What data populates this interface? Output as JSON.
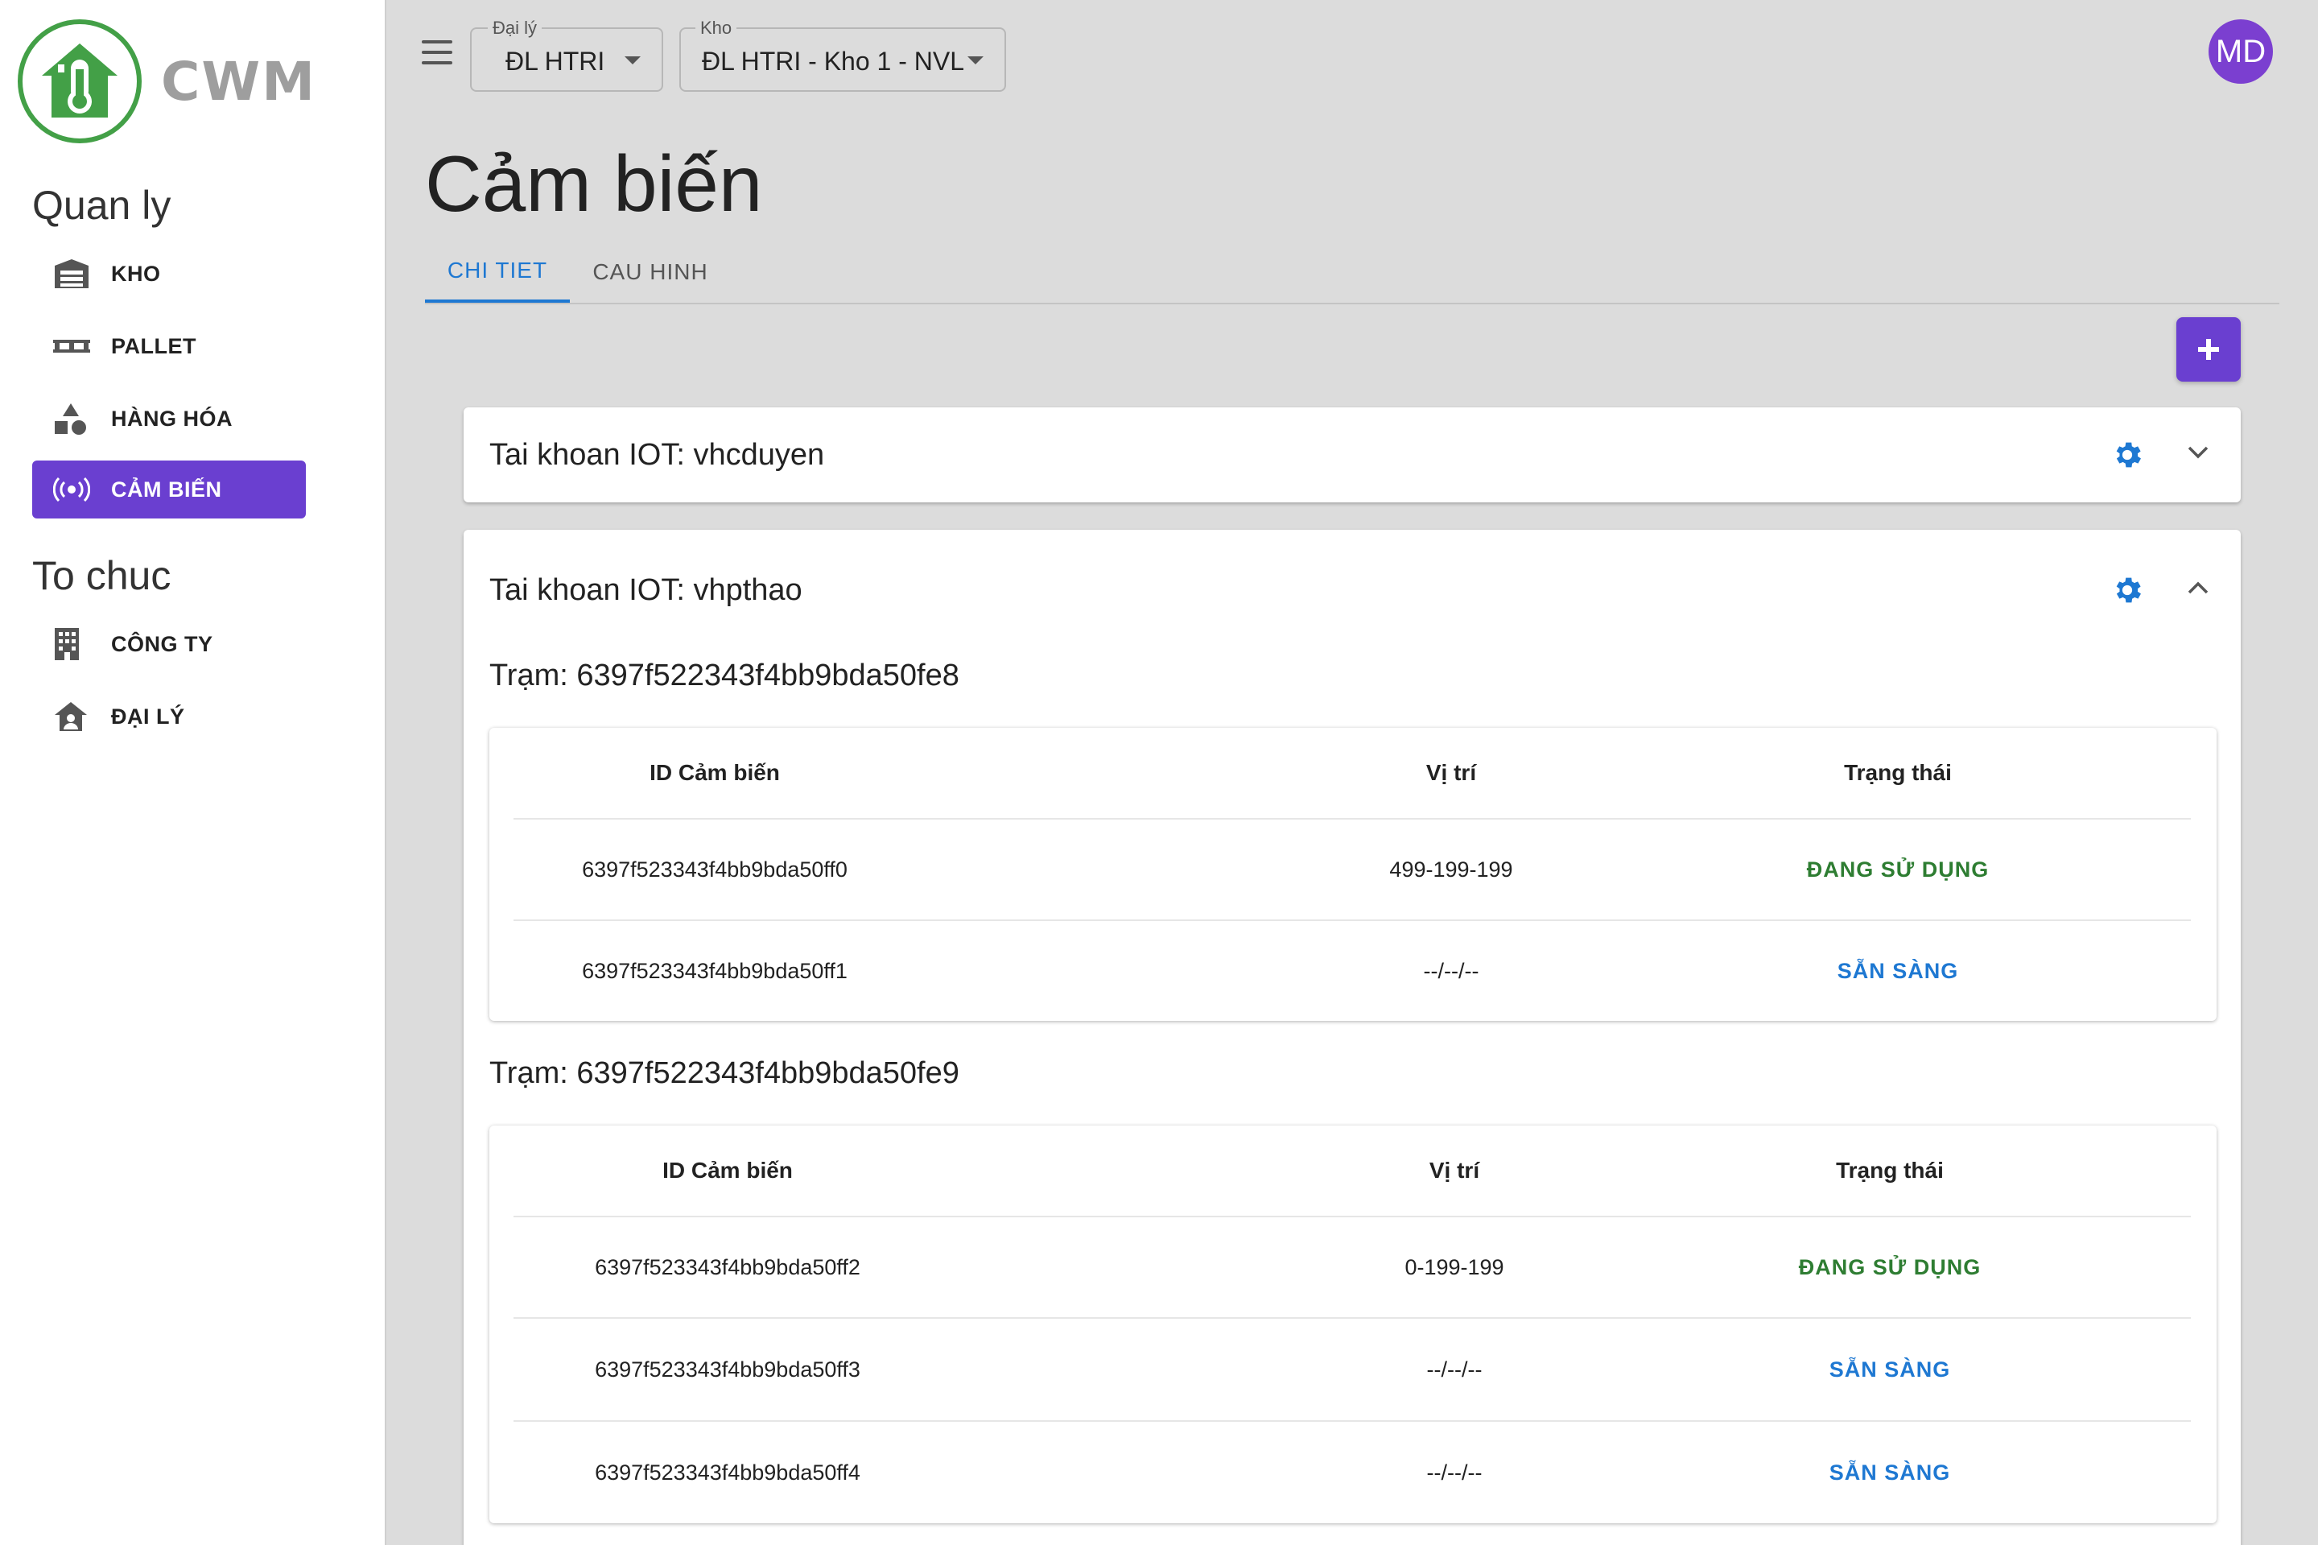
{
  "app": {
    "logo_text": "CWM"
  },
  "sidebar": {
    "section_manage": "Quan ly",
    "manage_items": [
      {
        "label": "KHO",
        "icon": "warehouse-icon"
      },
      {
        "label": "PALLET",
        "icon": "pallet-icon"
      },
      {
        "label": "HÀNG HÓA",
        "icon": "shapes-icon"
      },
      {
        "label": "CẢM BIẾN",
        "icon": "sensor-icon"
      }
    ],
    "section_org": "To chuc",
    "org_items": [
      {
        "label": "CÔNG TY",
        "icon": "building-icon"
      },
      {
        "label": "ĐẠI LÝ",
        "icon": "store-icon"
      }
    ]
  },
  "header": {
    "dealer_label": "Đại lý",
    "dealer_value": "ĐL HTRI",
    "warehouse_label": "Kho",
    "warehouse_value": "ĐL HTRI - Kho 1 - NVL",
    "avatar_initials": "MD"
  },
  "page": {
    "title": "Cảm biến",
    "tabs": [
      "CHI TIET",
      "CAU HINH"
    ],
    "active_tab": "CHI TIET"
  },
  "accounts": [
    {
      "title": "Tai khoan IOT: vhcduyen",
      "expanded": false
    },
    {
      "title": "Tai khoan IOT: vhpthao",
      "expanded": true,
      "stations": [
        {
          "title": "Trạm: 6397f522343f4bb9bda50fe8",
          "headers": [
            "ID Cảm biến",
            "Vị trí",
            "Trạng thái"
          ],
          "rows": [
            [
              "6397f523343f4bb9bda50ff0",
              "499-199-199",
              "ĐANG SỬ DỤNG"
            ],
            [
              "6397f523343f4bb9bda50ff1",
              "--/--/--",
              "SẴN SÀNG"
            ]
          ]
        },
        {
          "title": "Trạm: 6397f522343f4bb9bda50fe9",
          "headers": [
            "ID Cảm biến",
            "Vị trí",
            "Trạng thái"
          ],
          "rows": [
            [
              "6397f523343f4bb9bda50ff2",
              "0-199-199",
              "ĐANG SỬ DỤNG"
            ],
            [
              "6397f523343f4bb9bda50ff3",
              "--/--/--",
              "SẴN SÀNG"
            ],
            [
              "6397f523343f4bb9bda50ff4",
              "--/--/--",
              "SẴN SÀNG"
            ]
          ]
        }
      ]
    }
  ],
  "colors": {
    "accent": "#6a3fd0",
    "tab_active": "#1e78d2",
    "status_in_use": "#2e7d32",
    "status_ready": "#1e78d2",
    "logo_green": "#43a047"
  }
}
